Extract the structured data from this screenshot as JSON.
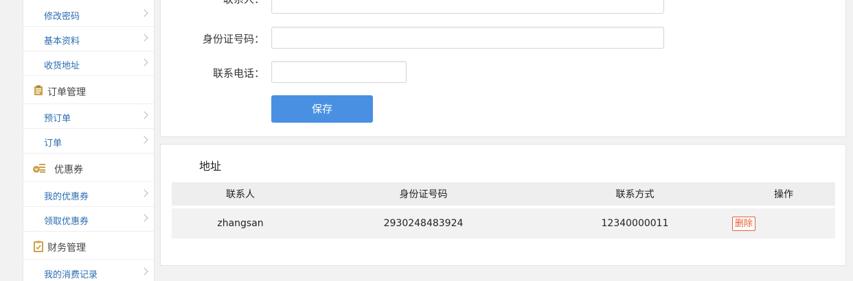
{
  "sidebar": {
    "account_items": [
      {
        "label": "修改密码"
      },
      {
        "label": "基本资料"
      },
      {
        "label": "收货地址"
      }
    ],
    "groups": [
      {
        "title": "订单管理",
        "icon": "clipboard-icon",
        "items": [
          {
            "label": "预订单"
          },
          {
            "label": "订单"
          }
        ]
      },
      {
        "title": "优惠券",
        "icon": "coupon-icon",
        "items": [
          {
            "label": "我的优惠券"
          },
          {
            "label": "领取优惠券"
          }
        ]
      },
      {
        "title": "财务管理",
        "icon": "finance-icon",
        "items": [
          {
            "label": "我的消费记录"
          }
        ]
      }
    ]
  },
  "form": {
    "contact_label": "联系人：",
    "contact_value": "",
    "id_label": "身份证号码：",
    "id_value": "",
    "phone_label": "联系电话：",
    "phone_value": "",
    "save_label": "保存"
  },
  "address": {
    "title": "地址",
    "columns": [
      "联系人",
      "身份证号码",
      "联系方式",
      "操作"
    ],
    "rows": [
      {
        "contact": "zhangsan",
        "id_number": "2930248483924",
        "phone": "12340000011",
        "action": "删除"
      }
    ]
  },
  "colors": {
    "primary": "#4a90e2",
    "link": "#2a6db0",
    "danger": "#e0623a",
    "icon_gold": "#c9a24a"
  }
}
